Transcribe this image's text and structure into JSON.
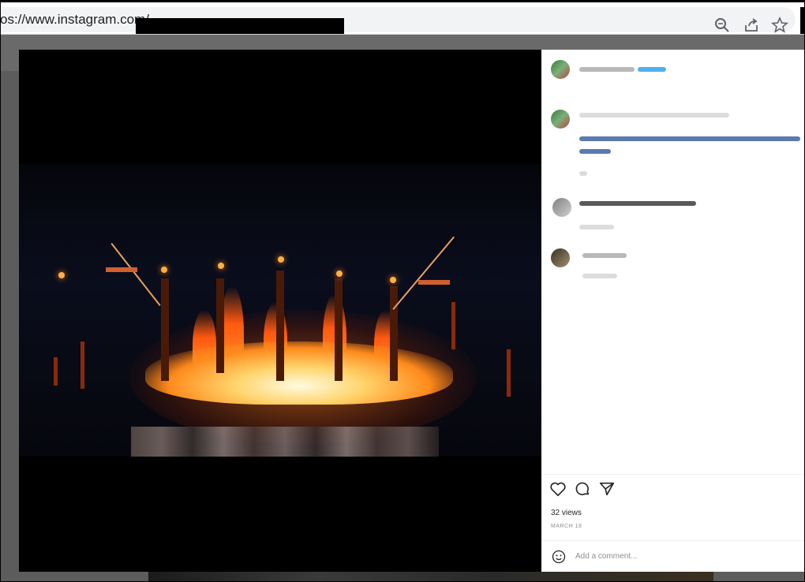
{
  "browser": {
    "url_prefix": "os://www.instagram.com/",
    "icons": [
      "zoom-icon",
      "share-icon",
      "bookmark-star-icon"
    ]
  },
  "post": {
    "views_text": "32 views",
    "date_text": "MARCH 18",
    "comment_placeholder": "Add a comment..."
  },
  "actions": {
    "icons": [
      "heart-icon",
      "comment-icon",
      "share-send-icon"
    ]
  },
  "colors": {
    "accent_blue": "#4fb0f0",
    "text_primary": "#262626",
    "text_secondary": "#8e8e8e"
  }
}
